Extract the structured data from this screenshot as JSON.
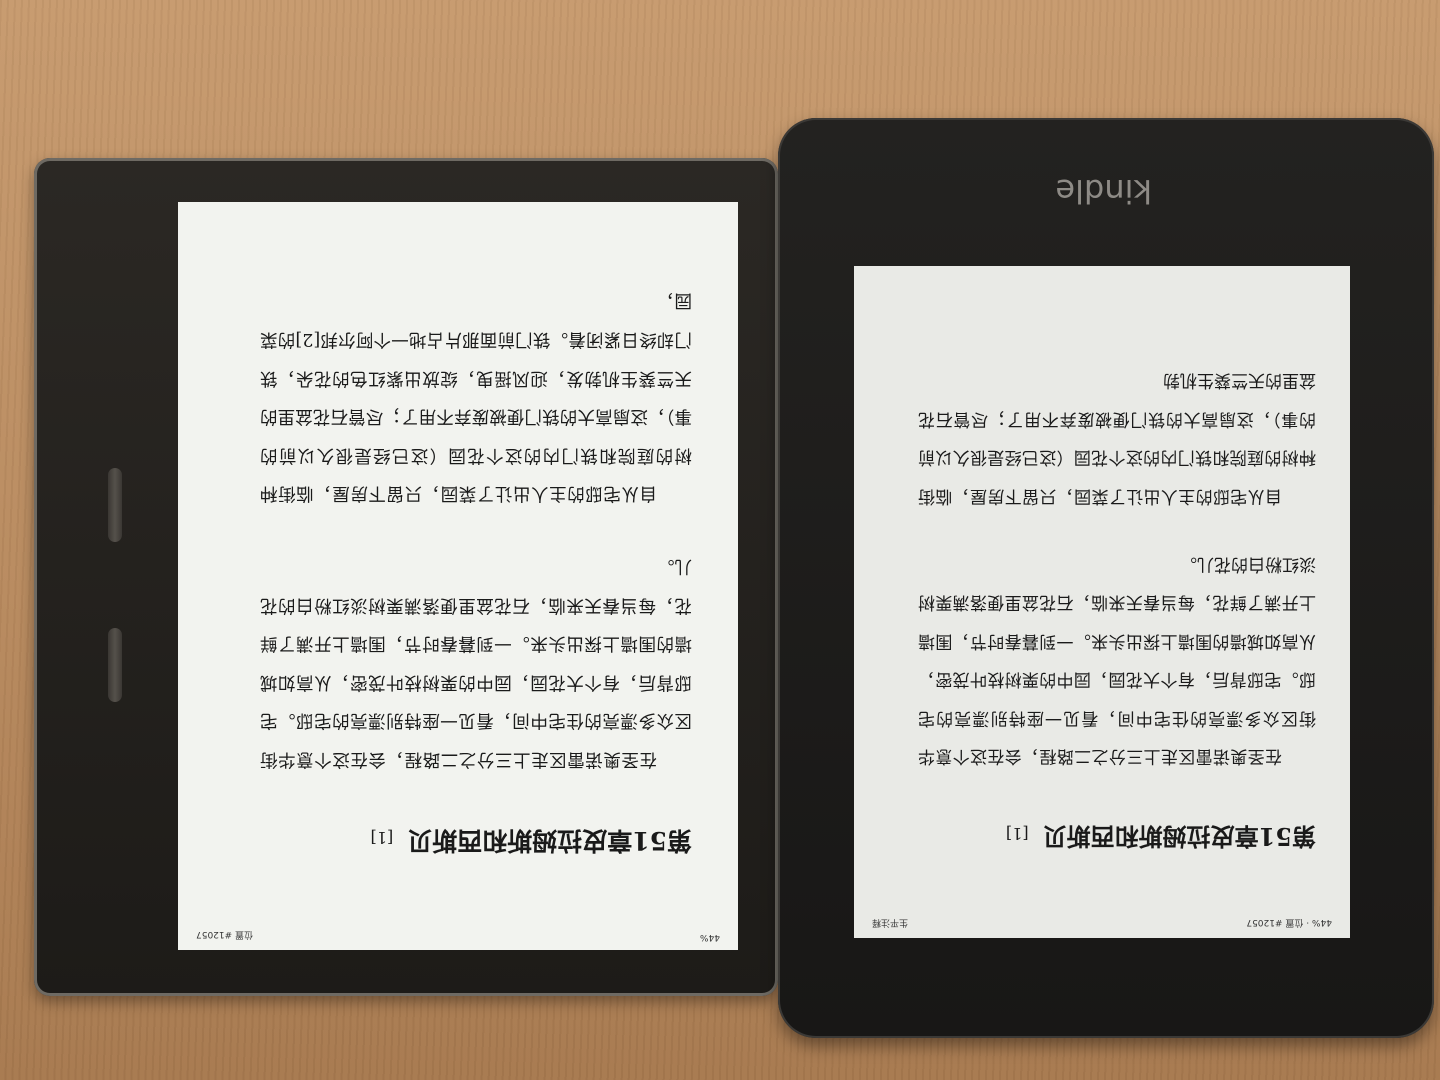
{
  "kindle_oasis": {
    "status_left": "44%",
    "status_right": "位置 #12057",
    "chapter_title": "第51章皮拉姆斯和西斯贝",
    "footnote_marker": "[1]",
    "paragraphs": [
      "在圣奥诺雷区走上三分之二路程，会在这个意华街区众多漂亮的住宅中间，看见一座特别漂亮的宅邸。宅邸背后，有个大花园，园中的栗树枝叶茂密，从高如城墙的围墙上探出头来。一到暮春时节，围墙上开满了鲜花，每当春天来临，石花盆里便落满栗树淡红粉白的花儿。",
      "自从宅邸的主人出让了菜园，只留下房屋，临街种树的庭院和铁门内的这个花园（这已经是很久以前的事），这扇高大的铁门便被废弃不用了；尽管石花盆里的天竺葵生机勃发，迎风摇曳，绽放出紫红色的花朵，铁门却终日紧闭着。铁门前面那片占地一个阿尔邦[2]的菜园，"
    ]
  },
  "kindle_paperwhite": {
    "logo": "kindle",
    "status_left": "44% · 位置 #12057",
    "status_right": "生平注释",
    "chapter_title": "第51章皮拉姆斯和西斯贝",
    "footnote_marker": "[1]",
    "paragraphs": [
      "在圣奥诺雷区走上三分之二路程，会在这个意华街区众多漂亮的住宅中间，看见一座特别漂亮的宅邸。宅邸背后，有个大花园，园中的栗树枝叶茂密，从高如城墙的围墙上探出头来。一到暮春时节，围墙上开满了鲜花，每当春天来临，石花盆里便落满栗树淡红粉白的花儿。",
      "自从宅邸的主人出让了菜园，只留下房屋，临街种树的庭院和铁门内的这个花园（这已经是很久以前的事），这扇高大的铁门便被废弃不用了；尽管石花盆里的天竺葵生机勃"
    ]
  }
}
